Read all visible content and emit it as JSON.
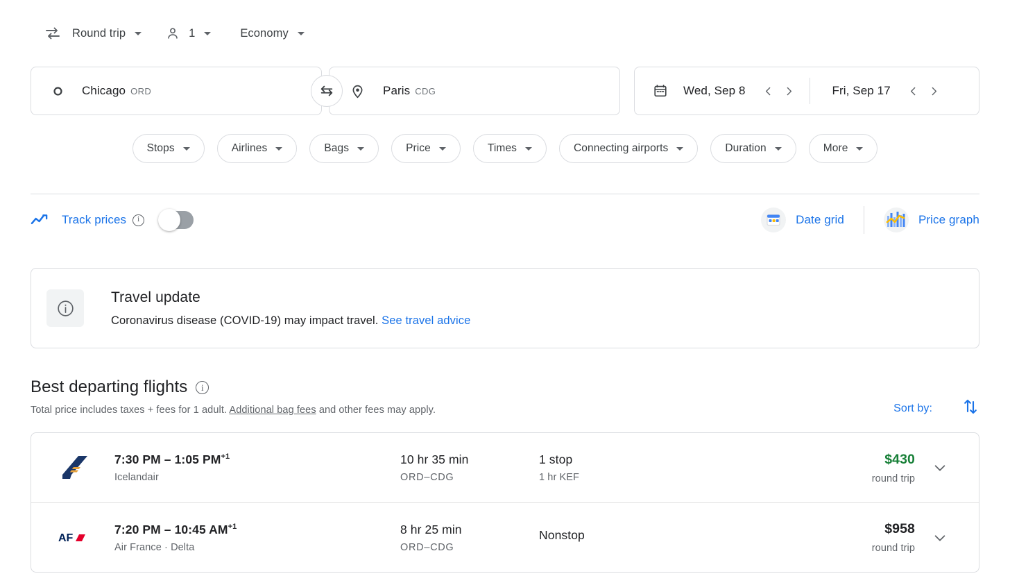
{
  "trip_options": {
    "trip_type": "Round trip",
    "passengers": "1",
    "cabin_class": "Economy"
  },
  "search": {
    "origin": {
      "city": "Chicago",
      "code": "ORD"
    },
    "destination": {
      "city": "Paris",
      "code": "CDG"
    },
    "depart_date": "Wed, Sep 8",
    "return_date": "Fri, Sep 17"
  },
  "filters": [
    {
      "label": "Stops"
    },
    {
      "label": "Airlines"
    },
    {
      "label": "Bags"
    },
    {
      "label": "Price"
    },
    {
      "label": "Times"
    },
    {
      "label": "Connecting airports"
    },
    {
      "label": "Duration"
    },
    {
      "label": "More"
    }
  ],
  "tools": {
    "track_prices_label": "Track prices",
    "track_prices_on": false,
    "date_grid_label": "Date grid",
    "price_graph_label": "Price graph"
  },
  "travel_update": {
    "title": "Travel update",
    "text": "Coronavirus disease (COVID-19) may impact travel.",
    "link_text": "See travel advice"
  },
  "best_departing": {
    "title": "Best departing flights",
    "subtitle_prefix": "Total price includes taxes + fees for 1 adult.",
    "subtitle_link": "Additional bag fees",
    "subtitle_suffix": "and other fees may apply.",
    "sort_label": "Sort by:"
  },
  "flights": [
    {
      "airline_logo": "icelandair-logo",
      "times": "7:30 PM – 1:05 PM",
      "day_offset": "+1",
      "airline": "Icelandair",
      "duration": "10 hr 35 min",
      "route": "ORD–CDG",
      "stops": "1 stop",
      "stop_detail": "1 hr KEF",
      "price": "$430",
      "price_note": "round trip",
      "price_color": "green"
    },
    {
      "airline_logo": "air-france-logo",
      "times": "7:20 PM – 10:45 AM",
      "day_offset": "+1",
      "airline": "Air France · Delta",
      "duration": "8 hr 25 min",
      "route": "ORD–CDG",
      "stops": "Nonstop",
      "stop_detail": "",
      "price": "$958",
      "price_note": "round trip",
      "price_color": "plain"
    }
  ],
  "colors": {
    "accent_blue": "#1a73e8",
    "price_green": "#188038",
    "border": "#dadce0",
    "text_primary": "#202124",
    "text_secondary": "#5f6368"
  }
}
